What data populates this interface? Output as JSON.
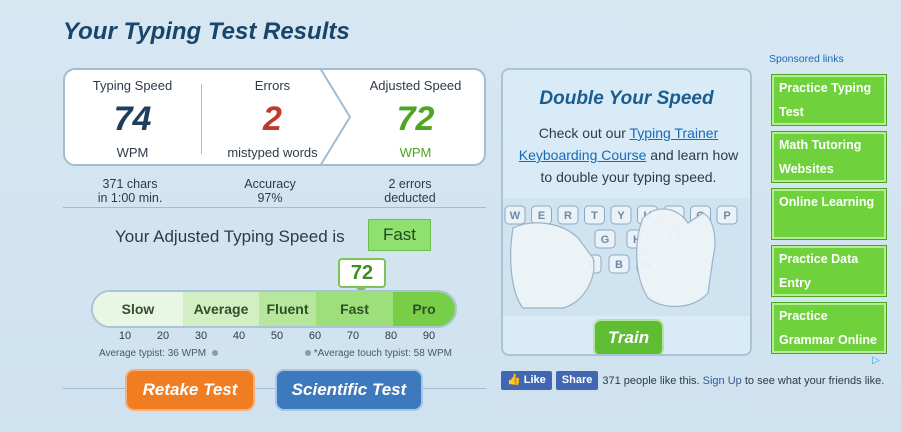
{
  "page": {
    "title": "Your Typing Test Results"
  },
  "stats": {
    "speed": {
      "label": "Typing Speed",
      "value": "74",
      "unit": "WPM"
    },
    "errors": {
      "label": "Errors",
      "value": "2",
      "unit": "mistyped words"
    },
    "adjusted": {
      "label": "Adjusted Speed",
      "value": "72",
      "unit": "WPM"
    }
  },
  "details": {
    "chars_line1": "371 chars",
    "chars_line2": "in 1:00 min.",
    "accuracy_label": "Accuracy",
    "accuracy_value": "97%",
    "deducted_line1": "2 errors",
    "deducted_line2": "deducted"
  },
  "rating": {
    "prefix": "Your Adjusted Typing Speed is",
    "badge": "Fast"
  },
  "scale": {
    "pointer_value": "72",
    "segments": [
      {
        "label": "Slow",
        "color": "#eaf6e4"
      },
      {
        "label": "Average",
        "color": "#d2efc4"
      },
      {
        "label": "Fluent",
        "color": "#b6e79c"
      },
      {
        "label": "Fast",
        "color": "#9ddf79"
      },
      {
        "label": "Pro",
        "color": "#78cf47"
      }
    ],
    "ticks": [
      "10",
      "20",
      "30",
      "40",
      "50",
      "60",
      "70",
      "80",
      "90"
    ],
    "note_average": "Average typist: 36 WPM",
    "note_touch": "*Average touch typist: 58 WPM"
  },
  "buttons": {
    "retake": "Retake Test",
    "scientific": "Scientific Test"
  },
  "promo": {
    "title": "Double Your Speed",
    "text_before": "Check out our ",
    "link1": "Typing Trainer",
    "link2": "Keyboarding Course",
    "text_after": " and learn how to double your typing speed.",
    "train_button": "Train",
    "keys_row1": [
      "W",
      "E",
      "R",
      "T",
      "Y",
      "U",
      "I",
      "O",
      "P"
    ],
    "keys_row2": [
      "G",
      "H",
      "J"
    ],
    "keys_row3": [
      "V",
      "B",
      "N"
    ]
  },
  "facebook": {
    "like": "Like",
    "share": "Share",
    "text1": "371 people like this.",
    "signup": "Sign Up",
    "text2": "to see what your friends like."
  },
  "sponsored": {
    "label": "Sponsored links",
    "ads": [
      "Practice Typing Test",
      "Math Tutoring Websites",
      "Online Learning",
      "Practice Data Entry",
      "Practice Grammar Online"
    ]
  },
  "colors": {
    "accent_green": "#6fd13c",
    "retake": "#f07d22",
    "scientific": "#3d79bd",
    "errors": "#c0392b"
  }
}
